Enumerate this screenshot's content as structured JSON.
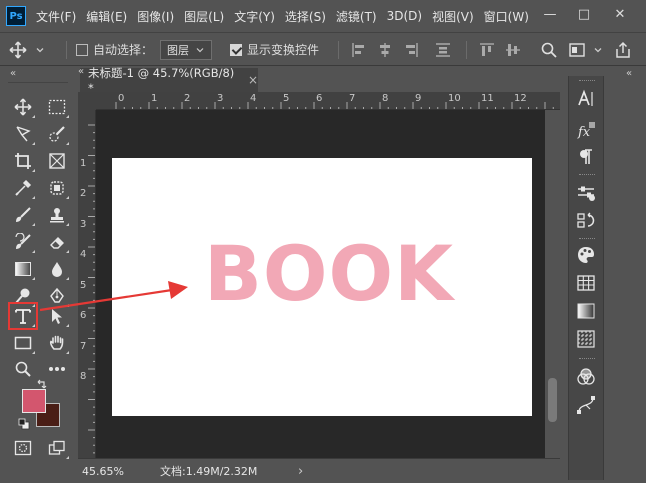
{
  "app": {
    "logo": "Ps"
  },
  "menu": [
    "文件(F)",
    "编辑(E)",
    "图像(I)",
    "图层(L)",
    "文字(Y)",
    "选择(S)",
    "滤镜(T)",
    "3D(D)",
    "视图(V)",
    "窗口(W)"
  ],
  "window_controls": {
    "minimize": "—",
    "maximize": "□",
    "close": "✕"
  },
  "options": {
    "auto_select_label": "自动选择：",
    "auto_select_checked": false,
    "layer_select_value": "图层",
    "show_transform_label": "显示变换控件",
    "show_transform_checked": true
  },
  "document": {
    "tab_title": "未标题-1 @ 45.7%(RGB/8) *",
    "tab_close": "×",
    "canvas_text": "BOOK",
    "canvas_text_color": "#f2a8b6"
  },
  "rulers": {
    "h_ticks": [
      "0",
      "1",
      "2",
      "3",
      "4",
      "5",
      "6",
      "7",
      "8",
      "9",
      "10",
      "11",
      "12"
    ],
    "v_ticks": [
      "1",
      "2",
      "3",
      "4",
      "5",
      "6",
      "7",
      "8"
    ]
  },
  "status": {
    "zoom": "45.65%",
    "doc_info": "文档:1.49M/2.32M",
    "arrow": "›"
  },
  "colors": {
    "foreground": "#d3566e",
    "background": "#4a1e16",
    "highlight": "#e53935"
  },
  "tools": [
    "move-icon",
    "marquee-icon",
    "lasso-icon",
    "quick-select-icon",
    "crop-icon",
    "frame-icon",
    "eyedropper-icon",
    "healing-icon",
    "brush-icon",
    "stamp-icon",
    "history-brush-icon",
    "eraser-icon",
    "gradient-icon",
    "blur-icon",
    "dodge-icon",
    "pen-icon",
    "type-icon",
    "path-select-icon",
    "rectangle-icon",
    "hand-icon",
    "zoom-icon",
    "more-icon"
  ],
  "right_panel_icons": [
    "character-icon",
    "styles-icon",
    "paragraph-icon",
    "adjustments-icon",
    "channels-icon",
    "swatches-icon",
    "grid-icon",
    "gradient-panel-icon",
    "pattern-icon",
    "color-icon",
    "paths-icon"
  ]
}
